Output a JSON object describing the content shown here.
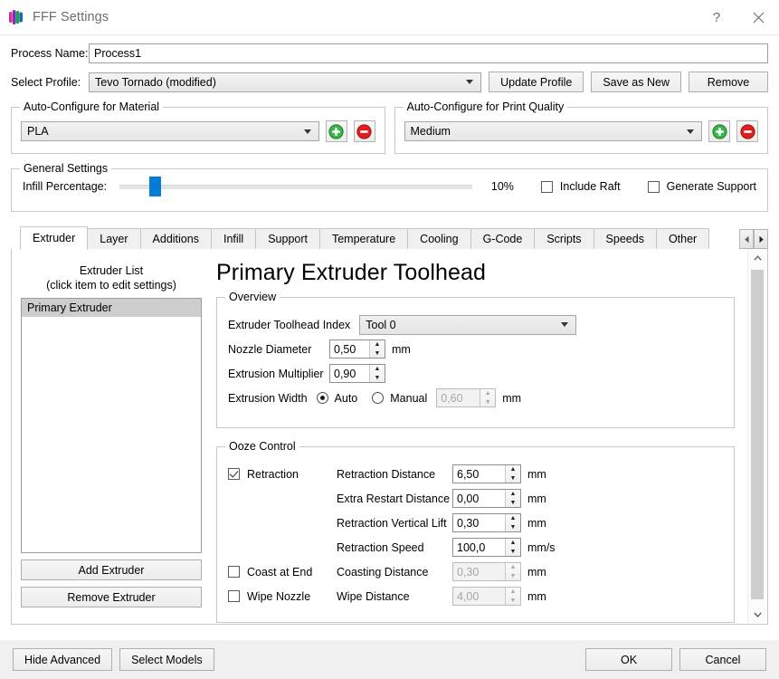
{
  "window": {
    "title": "FFF Settings",
    "icon": "fff-app-icon",
    "help_label": "?",
    "close_label": "close-icon"
  },
  "process": {
    "name_label": "Process Name:",
    "name_value": "Process1",
    "name_placeholder": "",
    "profile_label": "Select Profile:",
    "profile_value": "Tevo Tornado (modified)",
    "update_profile": "Update Profile",
    "save_as_new": "Save as New",
    "remove": "Remove"
  },
  "material": {
    "group_title": "Auto-Configure for Material",
    "value": "PLA",
    "add_icon": "plus-circle-icon",
    "remove_icon": "minus-circle-icon"
  },
  "quality": {
    "group_title": "Auto-Configure for Print Quality",
    "value": "Medium",
    "add_icon": "plus-circle-icon",
    "remove_icon": "minus-circle-icon"
  },
  "general": {
    "group_title": "General Settings",
    "infill_label": "Infill Percentage:",
    "infill_value": "10%",
    "infill_percent": 10,
    "include_raft_label": "Include Raft",
    "include_raft_checked": false,
    "generate_support_label": "Generate Support",
    "generate_support_checked": false
  },
  "tabs": {
    "items": [
      {
        "label": "Extruder",
        "active": true
      },
      {
        "label": "Layer",
        "active": false
      },
      {
        "label": "Additions",
        "active": false
      },
      {
        "label": "Infill",
        "active": false
      },
      {
        "label": "Support",
        "active": false
      },
      {
        "label": "Temperature",
        "active": false
      },
      {
        "label": "Cooling",
        "active": false
      },
      {
        "label": "G-Code",
        "active": false
      },
      {
        "label": "Scripts",
        "active": false
      },
      {
        "label": "Speeds",
        "active": false
      },
      {
        "label": "Other",
        "active": false
      }
    ],
    "scroll_left_icon": "chevron-left-icon",
    "scroll_right_icon": "chevron-right-icon"
  },
  "extruder_list": {
    "caption_line1": "Extruder List",
    "caption_line2": "(click item to edit settings)",
    "items": [
      "Primary Extruder"
    ],
    "selected": "Primary Extruder",
    "add_button": "Add Extruder",
    "remove_button": "Remove Extruder"
  },
  "page": {
    "title": "Primary Extruder Toolhead",
    "overview": {
      "group_title": "Overview",
      "toolhead_index_label": "Extruder Toolhead Index",
      "toolhead_index_value": "Tool 0",
      "nozzle_diameter_label": "Nozzle Diameter",
      "nozzle_diameter_value": "0,50",
      "nozzle_diameter_unit": "mm",
      "extrusion_multiplier_label": "Extrusion Multiplier",
      "extrusion_multiplier_value": "0,90",
      "extrusion_width_label": "Extrusion Width",
      "extrusion_width_auto_label": "Auto",
      "extrusion_width_manual_label": "Manual",
      "extrusion_width_mode": "Auto",
      "extrusion_width_value": "0,60",
      "extrusion_width_unit": "mm"
    },
    "ooze": {
      "group_title": "Ooze Control",
      "retraction_label": "Retraction",
      "retraction_checked": true,
      "retraction_distance_label": "Retraction Distance",
      "retraction_distance_value": "6,50",
      "retraction_distance_unit": "mm",
      "extra_restart_label": "Extra Restart Distance",
      "extra_restart_value": "0,00",
      "extra_restart_unit": "mm",
      "vertical_lift_label": "Retraction Vertical Lift",
      "vertical_lift_value": "0,30",
      "vertical_lift_unit": "mm",
      "retraction_speed_label": "Retraction Speed",
      "retraction_speed_value": "100,0",
      "retraction_speed_unit": "mm/s",
      "coast_at_end_label": "Coast at End",
      "coast_at_end_checked": false,
      "coasting_distance_label": "Coasting Distance",
      "coasting_distance_value": "0,30",
      "coasting_distance_unit": "mm",
      "wipe_nozzle_label": "Wipe Nozzle",
      "wipe_nozzle_checked": false,
      "wipe_distance_label": "Wipe Distance",
      "wipe_distance_value": "4,00",
      "wipe_distance_unit": "mm"
    }
  },
  "footer": {
    "hide_advanced": "Hide Advanced",
    "select_models": "Select Models",
    "ok": "OK",
    "cancel": "Cancel"
  },
  "colors": {
    "accent_blue": "#047cd6",
    "selection_gray": "#cdcdcd",
    "green": "#39b54a",
    "red": "#e02020"
  }
}
